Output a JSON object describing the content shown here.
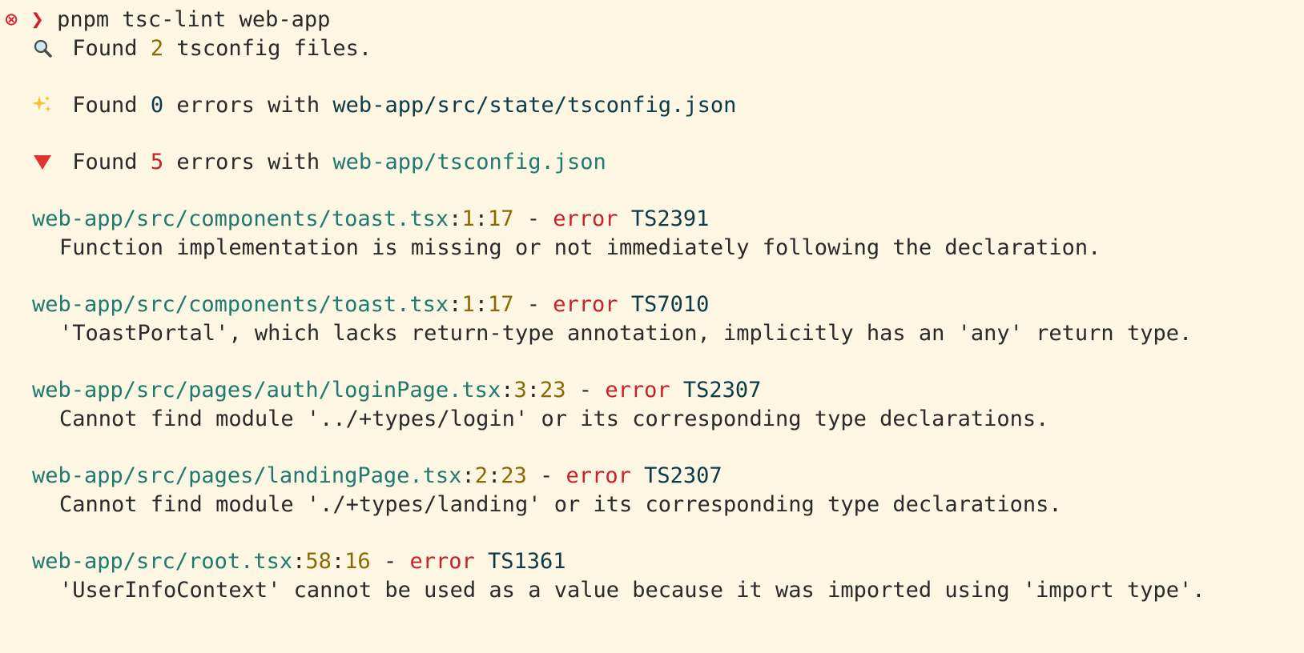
{
  "command": {
    "status_glyph": "⊗",
    "arrow": "❯",
    "text": "pnpm tsc-lint web-app"
  },
  "summary": {
    "found_prefix": "Found",
    "found_count": "2",
    "found_suffix": "tsconfig files."
  },
  "ok_config": {
    "found_prefix": "Found",
    "count": "0",
    "middle": "errors with",
    "path": "web-app/src/state/tsconfig.json"
  },
  "fail_config": {
    "found_prefix": "Found",
    "count": "5",
    "middle": "errors with",
    "path": "web-app/tsconfig.json"
  },
  "errors": [
    {
      "file": "web-app/src/components/toast.tsx",
      "line": "1",
      "col": "17",
      "dash": "-",
      "severity": "error",
      "code": "TS2391",
      "message": "Function implementation is missing or not immediately following the declaration."
    },
    {
      "file": "web-app/src/components/toast.tsx",
      "line": "1",
      "col": "17",
      "dash": "-",
      "severity": "error",
      "code": "TS7010",
      "message": "'ToastPortal', which lacks return-type annotation, implicitly has an 'any' return type."
    },
    {
      "file": "web-app/src/pages/auth/loginPage.tsx",
      "line": "3",
      "col": "23",
      "dash": "-",
      "severity": "error",
      "code": "TS2307",
      "message": "Cannot find module '../+types/login' or its corresponding type declarations."
    },
    {
      "file": "web-app/src/pages/landingPage.tsx",
      "line": "2",
      "col": "23",
      "dash": "-",
      "severity": "error",
      "code": "TS2307",
      "message": "Cannot find module './+types/landing' or its corresponding type declarations."
    },
    {
      "file": "web-app/src/root.tsx",
      "line": "58",
      "col": "16",
      "dash": "-",
      "severity": "error",
      "code": "TS1361",
      "message": "'UserInfoContext' cannot be used as a value because it was imported using 'import type'."
    }
  ],
  "colors": {
    "background": "#fdf6e3",
    "path_teal": "#1f7a6e",
    "number_olive": "#8a6a00",
    "error_red": "#c8212a",
    "code_dark": "#0b3b46"
  },
  "icons": {
    "status": "error-circle-icon",
    "summary": "magnifier-icon",
    "ok": "sparkles-icon",
    "fail": "red-triangle-down-icon"
  }
}
